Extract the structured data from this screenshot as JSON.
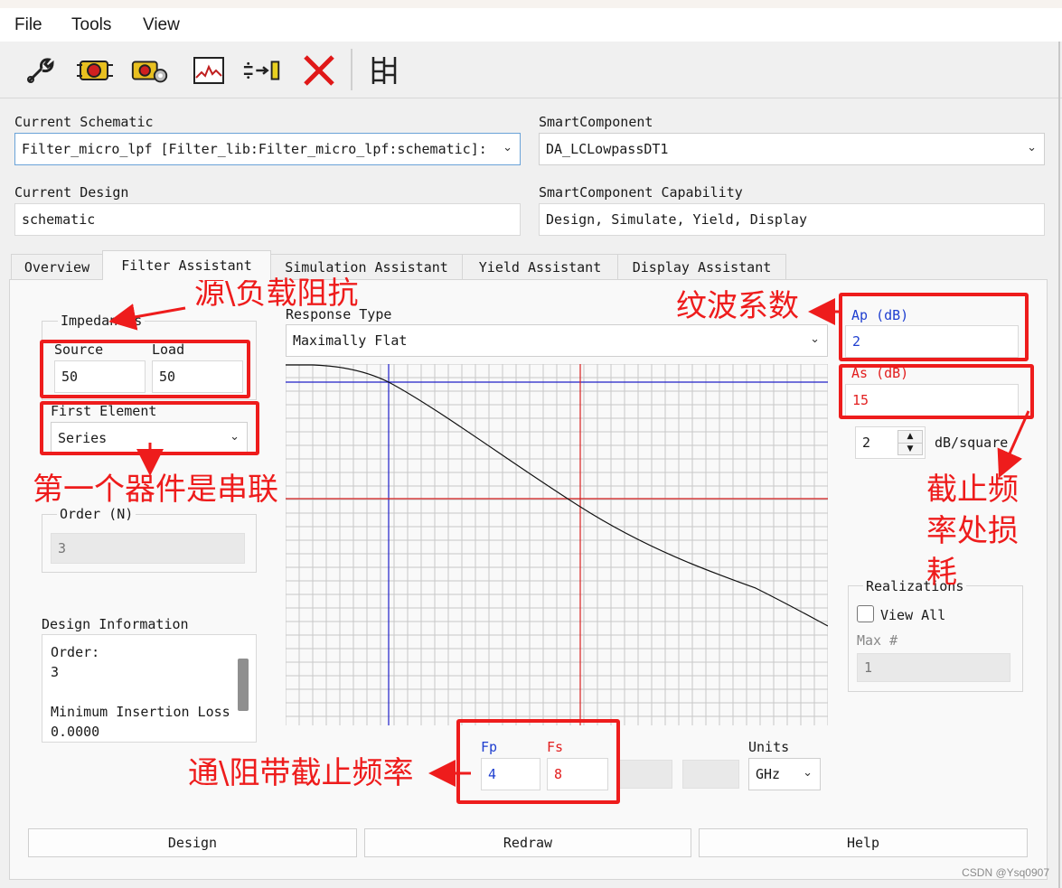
{
  "menu": {
    "file": "File",
    "tools": "Tools",
    "view": "View"
  },
  "toolbar": {
    "icons": [
      "wrench-icon",
      "component-icon",
      "component-settings-icon",
      "plot-icon",
      "connect-icon",
      "delete-icon",
      "grid-icon"
    ]
  },
  "header": {
    "current_schematic_label": "Current Schematic",
    "current_schematic_value": "Filter_micro_lpf [Filter_lib:Filter_micro_lpf:schematic]:",
    "smartcomponent_label": "SmartComponent",
    "smartcomponent_value": "DA_LCLowpassDT1",
    "current_design_label": "Current Design",
    "current_design_value": "schematic",
    "capability_label": "SmartComponent Capability",
    "capability_value": "Design, Simulate, Yield, Display"
  },
  "tabs": [
    {
      "label": "Overview"
    },
    {
      "label": "Filter Assistant"
    },
    {
      "label": "Simulation Assistant"
    },
    {
      "label": "Yield Assistant"
    },
    {
      "label": "Display Assistant"
    }
  ],
  "impedances": {
    "title": "Impedances",
    "source_label": "Source",
    "source_value": "50",
    "load_label": "Load",
    "load_value": "50"
  },
  "first_element": {
    "label": "First Element",
    "value": "Series"
  },
  "order": {
    "label": "Order (N)",
    "value": "3"
  },
  "design_info": {
    "label": "Design Information",
    "lines": [
      "Order:",
      "3",
      "",
      "Minimum Insertion Loss",
      "0.0000"
    ]
  },
  "response": {
    "label": "Response Type",
    "value": "Maximally Flat"
  },
  "ap": {
    "label": "Ap (dB)",
    "value": "2"
  },
  "as": {
    "label": "As (dB)",
    "value": "15"
  },
  "spin": {
    "value": "2",
    "unit": "dB/square"
  },
  "realizations": {
    "title": "Realizations",
    "view_all": "View All",
    "view_all_checked": false,
    "max_label": "Max #",
    "max_value": "1"
  },
  "freq": {
    "fp_label": "Fp",
    "fp_value": "4",
    "fs_label": "Fs",
    "fs_value": "8",
    "units_label": "Units",
    "units_value": "GHz"
  },
  "buttons": {
    "design": "Design",
    "redraw": "Redraw",
    "help": "Help"
  },
  "annotations": {
    "impedance": "源\\负载阻抗",
    "first_element": "第一个器件是串联",
    "ripple": "纹波系数",
    "stop_loss_1": "截止频",
    "stop_loss_2": "率处损",
    "stop_loss_3": "耗",
    "band_edges": "通\\阻带截止频率"
  },
  "watermark": "CSDN @Ysq0907",
  "colors": {
    "annotation": "#ee1c1c",
    "blue_label": "#1f3fd0",
    "red_label": "#e21e1e",
    "grid": "#c8c8c8"
  }
}
